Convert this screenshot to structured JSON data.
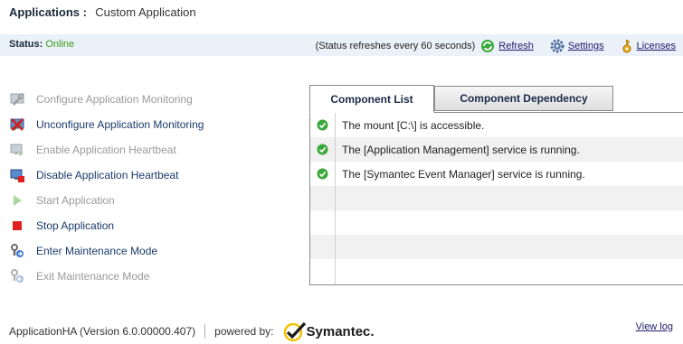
{
  "header": {
    "title_label": "Applications :",
    "title_value": "Custom Application"
  },
  "status": {
    "label": "Status:",
    "value": "Online",
    "refresh_note": "(Status refreshes every 60 seconds)",
    "refresh_label": "Refresh",
    "settings_label": "Settings",
    "licenses_label": "Licenses"
  },
  "actions": [
    {
      "label": "Configure Application Monitoring",
      "icon": "configure-icon",
      "enabled": false
    },
    {
      "label": "Unconfigure Application Monitoring",
      "icon": "unconfigure-icon",
      "enabled": true
    },
    {
      "label": "Enable Application Heartbeat",
      "icon": "heartbeat-enable-icon",
      "enabled": false
    },
    {
      "label": "Disable Application Heartbeat",
      "icon": "heartbeat-disable-icon",
      "enabled": true
    },
    {
      "label": "Start Application",
      "icon": "play-icon",
      "enabled": false
    },
    {
      "label": "Stop Application",
      "icon": "stop-icon",
      "enabled": true
    },
    {
      "label": "Enter Maintenance Mode",
      "icon": "maintenance-enter-icon",
      "enabled": true
    },
    {
      "label": "Exit Maintenance Mode",
      "icon": "maintenance-exit-icon",
      "enabled": false
    }
  ],
  "tabs": [
    {
      "label": "Component List",
      "active": true
    },
    {
      "label": "Component Dependency",
      "active": false
    }
  ],
  "components": [
    {
      "message": "The mount [C:\\] is accessible.",
      "status": "ok"
    },
    {
      "message": "The [Application Management] service is running.",
      "status": "ok"
    },
    {
      "message": "The [Symantec Event Manager] service is running.",
      "status": "ok"
    }
  ],
  "footer": {
    "version": "ApplicationHA (Version 6.0.00000.407)",
    "powered_by": "powered by:",
    "brand": "Symantec.",
    "view_log": "View log"
  },
  "colors": {
    "status_online": "#3a9a1a",
    "status_bar_bg": "#eaf1f8",
    "check_green": "#3aa83a",
    "brand_check": "#f2c200"
  }
}
